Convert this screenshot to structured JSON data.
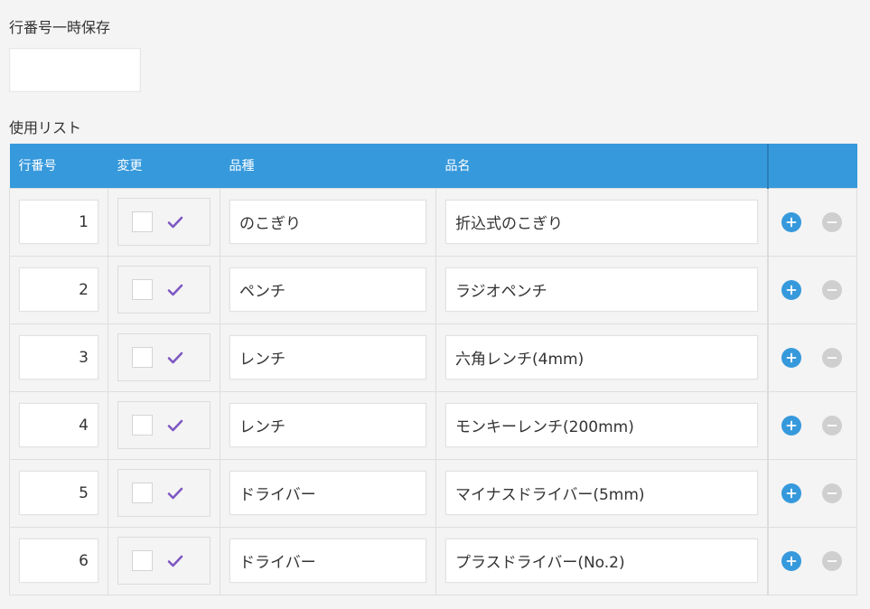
{
  "temp_save": {
    "label": "行番号一時保存",
    "value": ""
  },
  "use_list": {
    "label": "使用リスト",
    "columns": [
      "行番号",
      "変更",
      "品種",
      "品名"
    ],
    "rows": [
      {
        "no": "1",
        "type": "のこぎり",
        "name": "折込式のこぎり"
      },
      {
        "no": "2",
        "type": "ペンチ",
        "name": "ラジオペンチ"
      },
      {
        "no": "3",
        "type": "レンチ",
        "name": "六角レンチ(4mm)"
      },
      {
        "no": "4",
        "type": "レンチ",
        "name": "モンキーレンチ(200mm)"
      },
      {
        "no": "5",
        "type": "ドライバー",
        "name": "マイナスドライバー(5mm)"
      },
      {
        "no": "6",
        "type": "ドライバー",
        "name": "プラスドライバー(No.2)"
      }
    ]
  },
  "colors": {
    "header": "#3699dc",
    "check": "#7e57c2",
    "add": "#3699dc",
    "remove": "#cfcfcf"
  },
  "icons": {
    "check": "check-icon",
    "add": "plus-circle-icon",
    "remove": "minus-circle-icon"
  }
}
